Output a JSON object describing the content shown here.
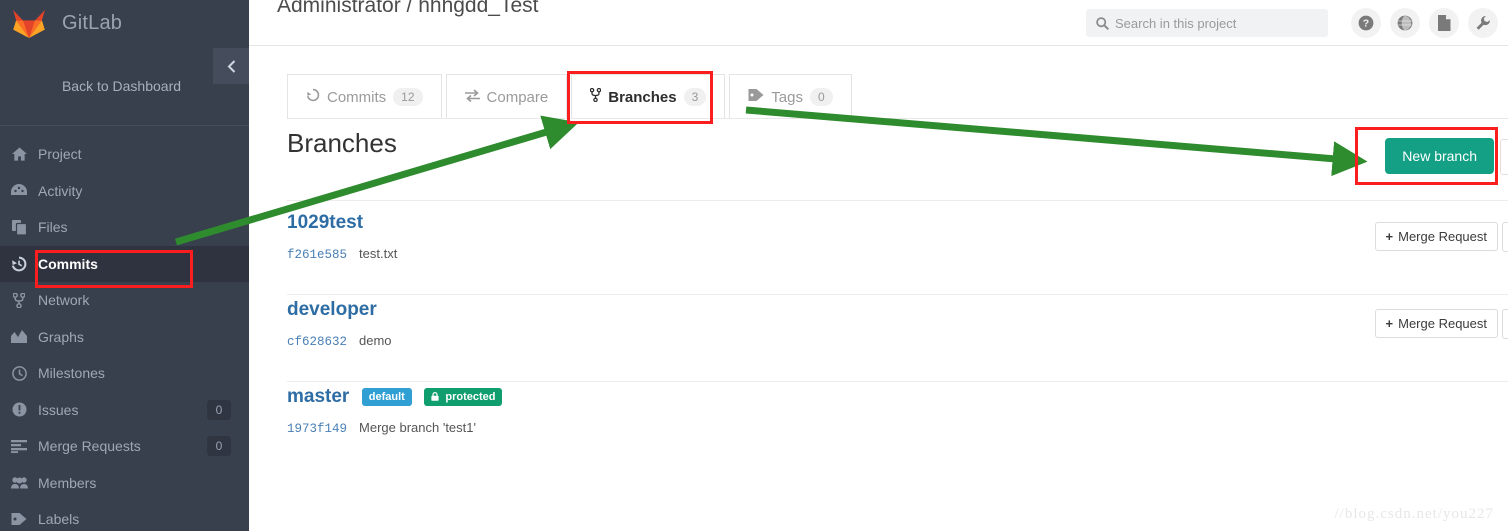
{
  "app": {
    "brand_name": "GitLab",
    "logo_icon": "gitlab-fox-logo",
    "collapse_icon": "chevron-left-icon"
  },
  "sidebar": {
    "back_to_dashboard": "Back to Dashboard",
    "items": [
      {
        "label": "Project",
        "icon": "home-icon",
        "badge": "",
        "active": false
      },
      {
        "label": "Activity",
        "icon": "dashboard-icon",
        "badge": "",
        "active": false
      },
      {
        "label": "Files",
        "icon": "files-icon",
        "badge": "",
        "active": false
      },
      {
        "label": "Commits",
        "icon": "history-icon",
        "badge": "",
        "active": true
      },
      {
        "label": "Network",
        "icon": "fork-icon",
        "badge": "",
        "active": false
      },
      {
        "label": "Graphs",
        "icon": "chart-icon",
        "badge": "",
        "active": false
      },
      {
        "label": "Milestones",
        "icon": "clock-icon",
        "badge": "",
        "active": false
      },
      {
        "label": "Issues",
        "icon": "exclamation-icon",
        "badge": "0",
        "active": false
      },
      {
        "label": "Merge Requests",
        "icon": "list-icon",
        "badge": "0",
        "active": false
      },
      {
        "label": "Members",
        "icon": "people-icon",
        "badge": "",
        "active": false
      },
      {
        "label": "Labels",
        "icon": "tag-icon",
        "badge": "",
        "active": false
      }
    ]
  },
  "header": {
    "page_title": "Administrator / hhhgdd_Test",
    "search_placeholder": "Search in this project",
    "search_value": "",
    "search_icon": "search-icon",
    "icons": [
      {
        "name": "help-icon",
        "glyph": "?"
      },
      {
        "name": "globe-icon",
        "glyph": "◑"
      },
      {
        "name": "files-icon",
        "glyph": "❐"
      },
      {
        "name": "wrench-icon",
        "glyph": "ὒ7"
      }
    ]
  },
  "tabs": [
    {
      "label": "Commits",
      "badge": "12",
      "icon": "history-icon",
      "active": false
    },
    {
      "label": "Compare",
      "badge": "",
      "icon": "compare-icon",
      "active": false
    },
    {
      "label": "Branches",
      "badge": "3",
      "icon": "fork-icon",
      "active": true
    },
    {
      "label": "Tags",
      "badge": "0",
      "icon": "tag-icon",
      "active": false
    }
  ],
  "main": {
    "section_title": "Branches",
    "new_branch_label": "New branch",
    "merge_request_label": "Merge Request",
    "merge_request_icon": "plus-icon"
  },
  "branches": [
    {
      "name": "1029test",
      "sha": "f261e585",
      "commit_message": "test.txt",
      "badges": []
    },
    {
      "name": "developer",
      "sha": "cf628632",
      "commit_message": "demo",
      "badges": []
    },
    {
      "name": "master",
      "sha": "1973f149",
      "commit_message": "Merge branch 'test1'",
      "badges": [
        {
          "label": "default",
          "type": "default",
          "icon": ""
        },
        {
          "label": "protected",
          "type": "protected",
          "icon": "lock-icon"
        }
      ]
    }
  ],
  "watermark": "//blog.csdn.net/you227",
  "colors": {
    "sidebar_bg": "#383f4d",
    "sidebar_active_bg": "#2e333f",
    "new_branch_green": "#13a085",
    "badge_default_blue": "#2f9fd4",
    "badge_protected_green": "#109e6e",
    "branch_link_blue": "#2e6da4",
    "annotation_red": "#fa1e1e",
    "annotation_green": "#2e8b2e"
  }
}
